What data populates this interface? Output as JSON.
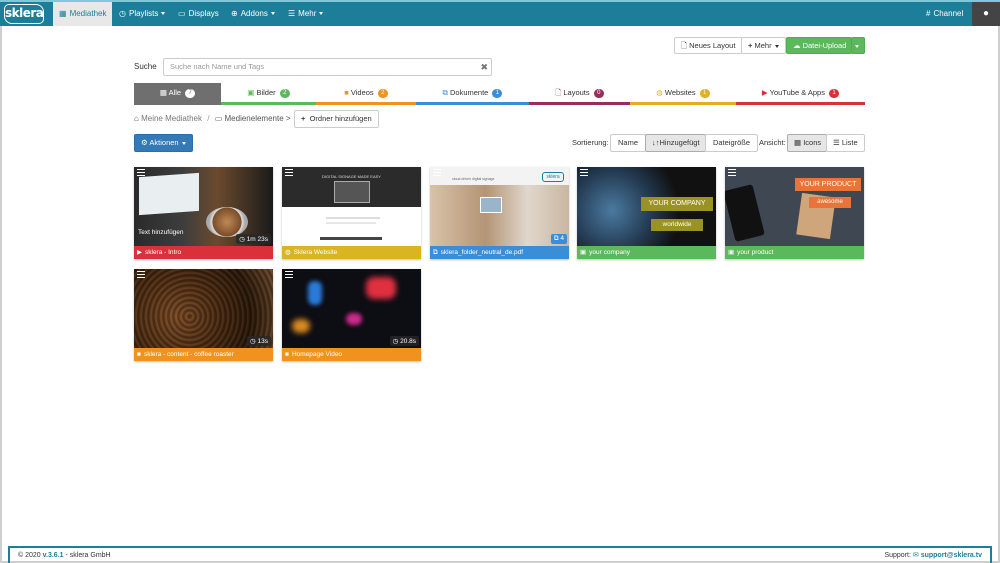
{
  "nav": {
    "logo": "sklera",
    "items": [
      {
        "label": "Mediathek",
        "icon": "grid-icon",
        "active": true
      },
      {
        "label": "Playlists",
        "icon": "clock-icon",
        "dropdown": true
      },
      {
        "label": "Displays",
        "icon": "monitor-icon"
      },
      {
        "label": "Addons",
        "icon": "plus-circle-icon",
        "dropdown": true
      },
      {
        "label": "Mehr",
        "icon": "list-icon",
        "dropdown": true
      }
    ],
    "channel": "Channel"
  },
  "toolbar": {
    "new_layout": "Neues Layout",
    "more": "Mehr",
    "upload": "Datei-Upload"
  },
  "search": {
    "label": "Suche",
    "placeholder": "Suche nach Name und Tags"
  },
  "tabs": [
    {
      "label": "Alle",
      "count": "7",
      "color": "#6f6f6f",
      "badge": "#ffffff"
    },
    {
      "label": "Bilder",
      "count": "2",
      "color": "#5cb85c",
      "badge": "#5cb85c"
    },
    {
      "label": "Videos",
      "count": "2",
      "color": "#f0931e",
      "badge": "#f0931e"
    },
    {
      "label": "Dokumente",
      "count": "1",
      "color": "#3a8ed8",
      "badge": "#3a8ed8"
    },
    {
      "label": "Layouts",
      "count": "0",
      "color": "#9b2d5c",
      "badge": "#9b2d5c"
    },
    {
      "label": "Websites",
      "count": "1",
      "color": "#e0b021",
      "badge": "#e0b021"
    },
    {
      "label": "YouTube & Apps",
      "count": "1",
      "color": "#d9303a",
      "badge": "#d9303a"
    }
  ],
  "breadcrumb": {
    "root": "Meine Mediathek",
    "sep": "/",
    "current": "Medienelemente >",
    "add_folder": "Ordner hinzufügen"
  },
  "actions": "Aktionen",
  "sorting": {
    "label": "Sortierung:",
    "options": [
      "Name",
      "Hinzugefügt",
      "Dateigröße"
    ],
    "selected": "Hinzugefügt"
  },
  "view": {
    "label": "Ansicht:",
    "options": [
      "Icons",
      "Liste"
    ],
    "selected": "Icons"
  },
  "tiles": [
    {
      "title": "sklera - Intro",
      "color": "#d9303a",
      "duration": "1m 23s",
      "overlay": "Text hinzufügen",
      "type_icon": "youtube-icon"
    },
    {
      "title": "Sklera Website",
      "color": "#d9b521",
      "type_icon": "globe-icon",
      "overlay": "DIGITAL SIGNAGE MADE EASY"
    },
    {
      "title": "sklera_folder_neutral_de.pdf",
      "color": "#3a8ed8",
      "duration": "4",
      "type_icon": "documents-icon",
      "overlay": "sklera",
      "overlay2": "cloud-driven digital signage"
    },
    {
      "title": "your company",
      "color": "#5cb85c",
      "type_icon": "image-icon",
      "overlay": "YOUR COMPANY",
      "overlay2": "worldwide"
    },
    {
      "title": "your product",
      "color": "#5cb85c",
      "type_icon": "image-icon",
      "overlay": "YOUR PRODUCT",
      "overlay2": "awesome"
    },
    {
      "title": "sklera - content - coffee roaster",
      "color": "#f0931e",
      "duration": "13s",
      "type_icon": "video-icon"
    },
    {
      "title": "Homepage Video",
      "color": "#f0931e",
      "duration": "20.8s",
      "type_icon": "video-icon"
    }
  ],
  "footer": {
    "copyright": "© 2020",
    "version": "v.3.6.1",
    "company": "- sklera GmbH",
    "support_label": "Support:",
    "support_email": "support@sklera.tv"
  }
}
